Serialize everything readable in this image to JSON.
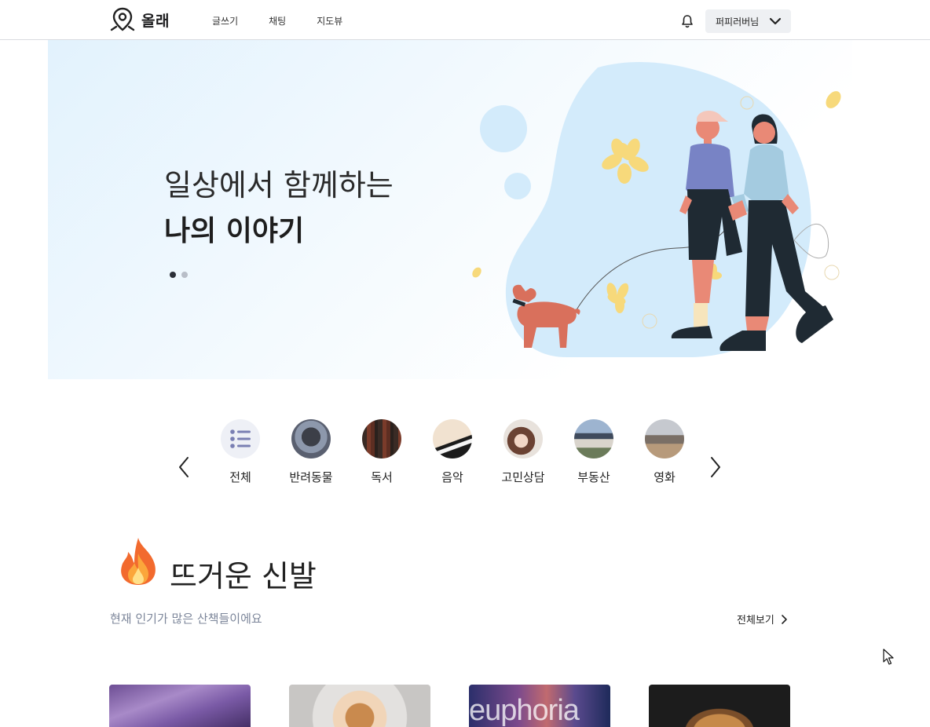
{
  "header": {
    "logo_text": "올래",
    "nav": [
      "글쓰기",
      "채팅",
      "지도뷰"
    ],
    "user_name": "퍼피러버님",
    "icons": {
      "logo": "map-pin-icon",
      "bell": "bell-icon",
      "chevron": "chevron-down-icon"
    }
  },
  "hero": {
    "line1": "일상에서 함께하는",
    "line2": "나의 이야기",
    "slides": 2,
    "active_slide": 1
  },
  "categories": {
    "items": [
      {
        "label": "전체",
        "icon": "list-icon"
      },
      {
        "label": "반려동물"
      },
      {
        "label": "독서"
      },
      {
        "label": "음악"
      },
      {
        "label": "고민상담"
      },
      {
        "label": "부동산"
      },
      {
        "label": "영화"
      }
    ]
  },
  "hot": {
    "title": "뜨거운 신발",
    "subtitle": "현재 인기가 많은 산책들이에요",
    "view_all": "전체보기",
    "cards": [
      {
        "text": ""
      },
      {
        "text": ""
      },
      {
        "text": "euphoria"
      },
      {
        "text": ""
      }
    ]
  },
  "colors": {
    "accent_blue": "#d3ebfb",
    "text_muted": "#7c869a",
    "flower_yellow": "#f7d97b",
    "dog": "#d9705c"
  }
}
